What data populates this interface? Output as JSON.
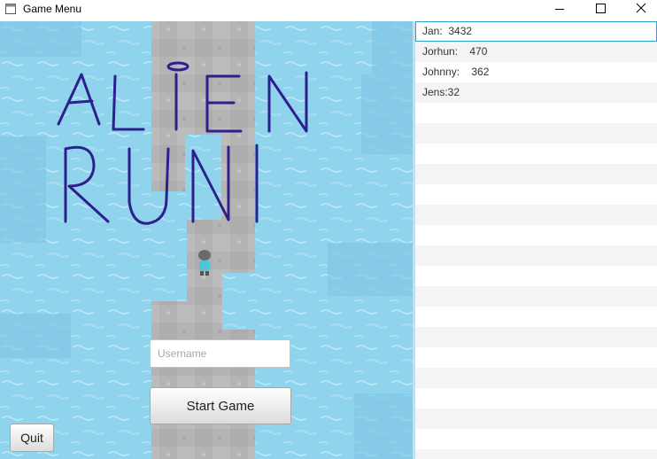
{
  "window": {
    "title": "Game Menu",
    "minimize_icon": "minimize-icon",
    "maximize_icon": "maximize-icon",
    "close_icon": "close-icon"
  },
  "game": {
    "logo_text": "ALIEN RUN",
    "username_placeholder": "Username",
    "username_value": "",
    "start_label": "Start Game",
    "quit_label": "Quit"
  },
  "scores": [
    "Jan:  3432",
    "Jorhun:    470",
    "Johnny:    362",
    "Jens:32"
  ],
  "colors": {
    "water": "#8fd3ec",
    "path": "#b4b4b4",
    "logo": "#2e1f8f",
    "selection_border": "#2aa3c8"
  }
}
